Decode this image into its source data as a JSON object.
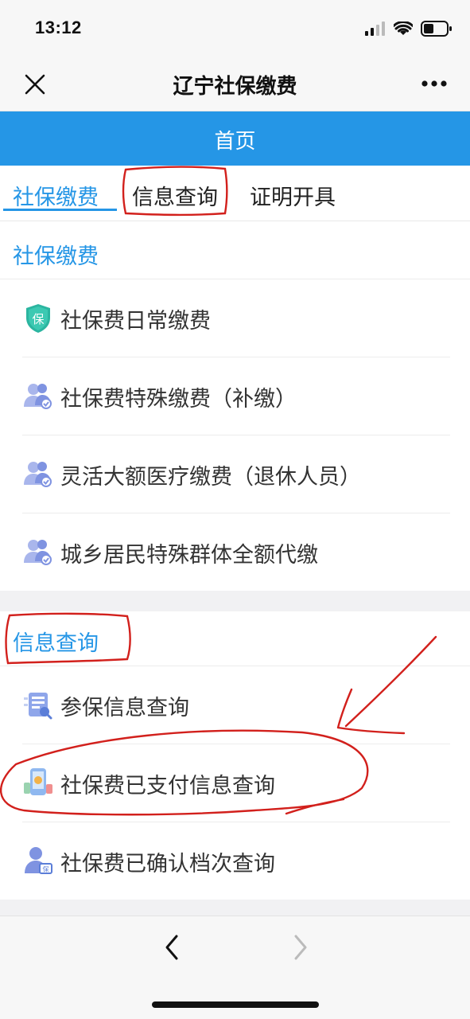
{
  "status_bar": {
    "time": "13:12"
  },
  "nav": {
    "title": "辽宁社保缴费",
    "close_icon": "close-icon",
    "more_icon": "more-icon"
  },
  "header": {
    "title": "首页",
    "color": "#2596e6"
  },
  "tabs": [
    {
      "label": "社保缴费",
      "active": true
    },
    {
      "label": "信息查询",
      "active": false
    },
    {
      "label": "证明开具",
      "active": false
    }
  ],
  "sections": [
    {
      "title": "社保缴费",
      "items": [
        {
          "label": "社保费日常缴费",
          "icon": "shield-icon"
        },
        {
          "label": "社保费特殊缴费（补缴）",
          "icon": "people-icon"
        },
        {
          "label": "灵活大额医疗缴费（退休人员）",
          "icon": "people-icon"
        },
        {
          "label": "城乡居民特殊群体全额代缴",
          "icon": "people-icon"
        }
      ]
    },
    {
      "title": "信息查询",
      "items": [
        {
          "label": "参保信息查询",
          "icon": "document-icon"
        },
        {
          "label": "社保费已支付信息查询",
          "icon": "phone-payment-icon"
        },
        {
          "label": "社保费已确认档次查询",
          "icon": "person-card-icon"
        }
      ]
    }
  ],
  "annotation_color": "#d2201c"
}
